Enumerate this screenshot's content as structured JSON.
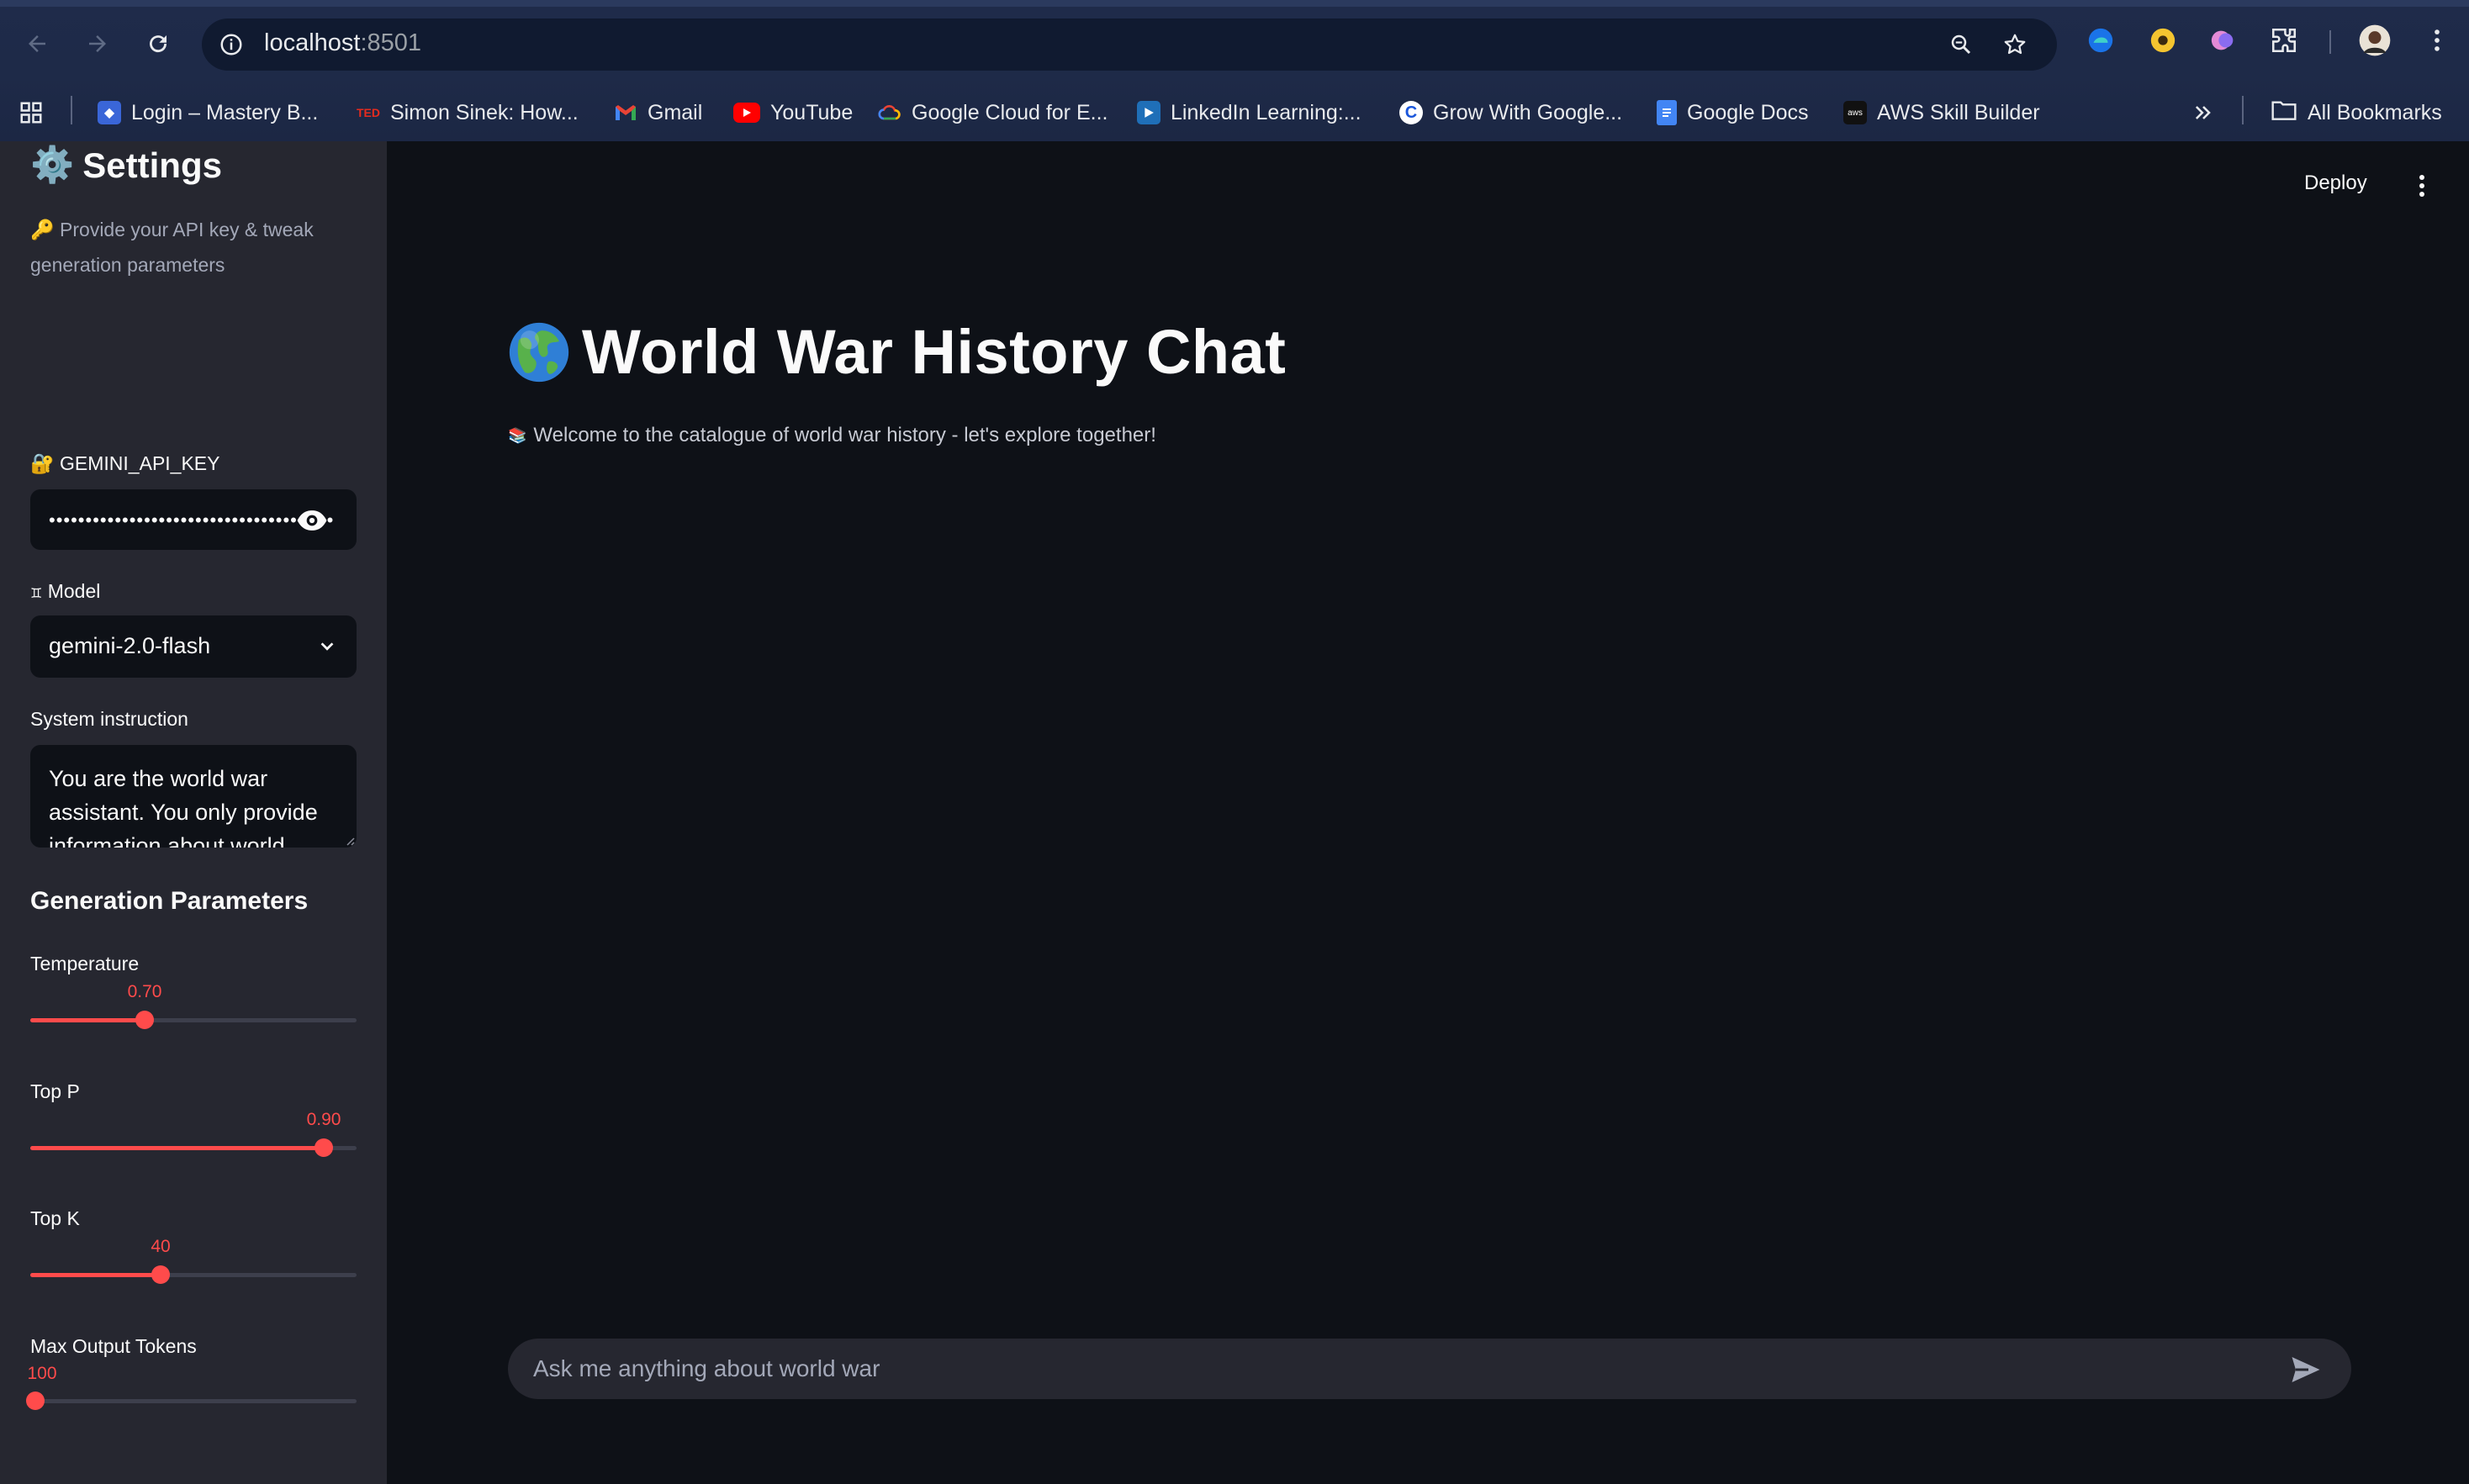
{
  "browser": {
    "url_host": "localhost",
    "url_port": ":8501",
    "bookmarks": [
      {
        "label": "Login – Mastery B...",
        "icon": "mastery-icon"
      },
      {
        "label": "Simon Sinek: How...",
        "icon": "ted-icon"
      },
      {
        "label": "Gmail",
        "icon": "gmail-icon"
      },
      {
        "label": "YouTube",
        "icon": "youtube-icon"
      },
      {
        "label": "Google Cloud for E...",
        "icon": "google-cloud-icon"
      },
      {
        "label": "LinkedIn Learning:...",
        "icon": "linkedin-learning-icon"
      },
      {
        "label": "Grow With Google...",
        "icon": "grow-with-google-icon"
      },
      {
        "label": "Google Docs",
        "icon": "google-docs-icon"
      },
      {
        "label": "AWS Skill Builder",
        "icon": "aws-icon"
      }
    ],
    "all_bookmarks": "All Bookmarks",
    "ted_text": "TED",
    "aws_text": "aws"
  },
  "sidebar": {
    "title_icon": "⚙️",
    "title": "Settings",
    "desc_icon": "🔑",
    "description": "Provide your API key & tweak generation parameters",
    "api_key_icon": "🔐",
    "api_key_label": "GEMINI_API_KEY",
    "api_key_masked": "•••••••••••••••••••••••••••••••••••••••",
    "model_icon": "♊",
    "model_label": "Model",
    "model_value": "gemini-2.0-flash",
    "system_label": "System instruction",
    "system_value": "You are the world war assistant. You only provide information about world",
    "gen_params_title": "Generation Parameters",
    "sliders": [
      {
        "label": "Temperature",
        "display": "0.70",
        "fraction": 0.35
      },
      {
        "label": "Top P",
        "display": "0.90",
        "fraction": 0.9
      },
      {
        "label": "Top K",
        "display": "40",
        "fraction": 0.4
      },
      {
        "label": "Max Output Tokens",
        "display": "100",
        "fraction": 0.01
      }
    ]
  },
  "main": {
    "deploy_label": "Deploy",
    "title_icon": "🌍",
    "title": "World War History Chat",
    "welcome_icon": "📚",
    "welcome": "Welcome to the catalogue of world war history - let's explore together!",
    "chat_placeholder": "Ask me anything about world war"
  },
  "colors": {
    "accent": "#ff4b4b",
    "sidebar_bg": "#262730",
    "main_bg": "#0e1117"
  }
}
